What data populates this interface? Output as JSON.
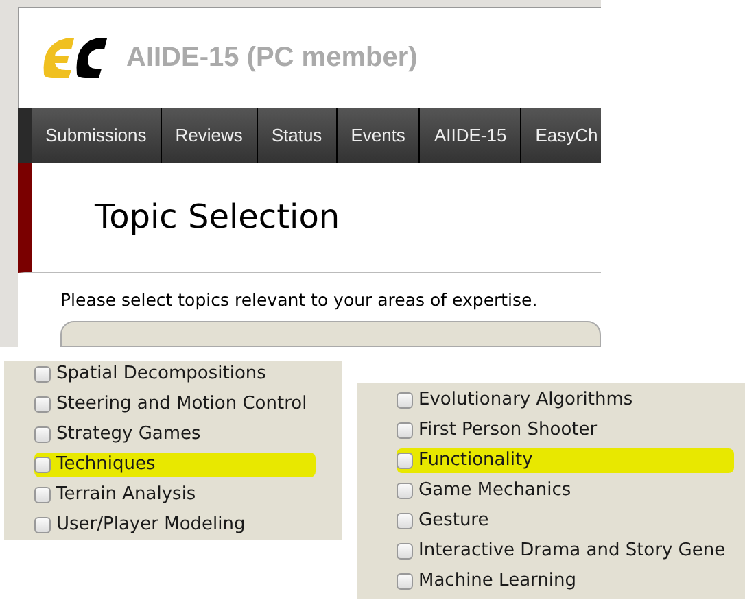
{
  "site": {
    "title": "AIIDE-15 (PC member)"
  },
  "nav": [
    {
      "label": "Submissions"
    },
    {
      "label": "Reviews"
    },
    {
      "label": "Status"
    },
    {
      "label": "Events"
    },
    {
      "label": "AIIDE-15"
    },
    {
      "label": "EasyCh"
    }
  ],
  "page": {
    "heading": "Topic Selection",
    "instruction": "Please select topics relevant to your areas of expertise."
  },
  "topic_panels": [
    {
      "topics": [
        {
          "label": "Spatial Decompositions",
          "checked": false,
          "highlighted": false
        },
        {
          "label": "Steering and Motion Control",
          "checked": false,
          "highlighted": false
        },
        {
          "label": "Strategy Games",
          "checked": false,
          "highlighted": false
        },
        {
          "label": "Techniques",
          "checked": false,
          "highlighted": true
        },
        {
          "label": "Terrain Analysis",
          "checked": false,
          "highlighted": false
        },
        {
          "label": "User/Player Modeling",
          "checked": false,
          "highlighted": false
        }
      ]
    },
    {
      "topics": [
        {
          "label": "Evolutionary Algorithms",
          "checked": false,
          "highlighted": false
        },
        {
          "label": "First Person Shooter",
          "checked": false,
          "highlighted": false
        },
        {
          "label": "Functionality",
          "checked": false,
          "highlighted": true
        },
        {
          "label": "Game Mechanics",
          "checked": false,
          "highlighted": false
        },
        {
          "label": "Gesture",
          "checked": false,
          "highlighted": false
        },
        {
          "label": "Interactive Drama and Story Gene",
          "checked": false,
          "highlighted": false
        },
        {
          "label": "Machine Learning",
          "checked": false,
          "highlighted": false
        }
      ]
    }
  ]
}
